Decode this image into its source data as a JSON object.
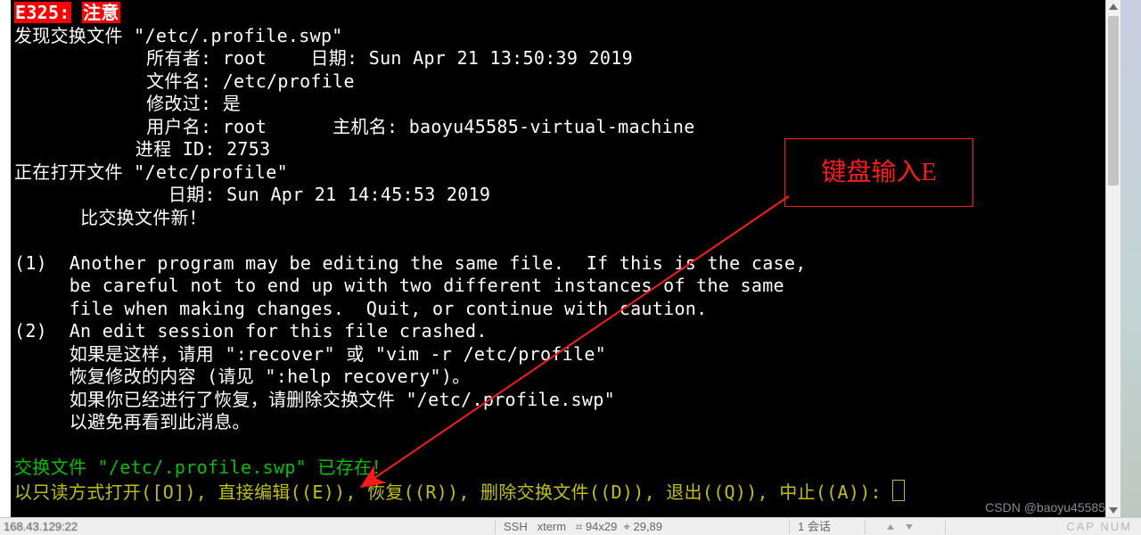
{
  "warning": {
    "code": "E325:",
    "label": "注意"
  },
  "swap": {
    "found_line": "发现交换文件 \"/etc/.profile.swp\"",
    "owner_label": "所有者:",
    "owner": "root",
    "date_label": "日期:",
    "date": "Sun Apr 21 13:50:39 2019",
    "filename_label": "文件名:",
    "filename": "/etc/profile",
    "modified_label": "修改过:",
    "modified": "是",
    "user_label": "用户名:",
    "user": "root",
    "host_label": "主机名:",
    "host": "baoyu45585-virtual-machine",
    "pid_label": "进程 ID:",
    "pid": "2753"
  },
  "opening": {
    "line": "正在打开文件 \"/etc/profile\"",
    "date_label": "日期:",
    "date": "Sun Apr 21 14:45:53 2019",
    "newer": "比交换文件新！"
  },
  "msg": {
    "l1": "(1)  Another program may be editing the same file.  If this is the case,",
    "l2": "     be careful not to end up with two different instances of the same",
    "l3": "     file when making changes.  Quit, or continue with caution.",
    "l4": "(2)  An edit session for this file crashed.",
    "l5": "     如果是这样，请用 \":recover\" 或 \"vim -r /etc/profile\"",
    "l6": "     恢复修改的内容 (请见 \":help recovery\")。",
    "l7": "     如果你已经进行了恢复，请删除交换文件 \"/etc/.profile.swp\"",
    "l8": "     以避免再看到此消息。"
  },
  "prompt": {
    "exists": "交换文件 \"/etc/.profile.swp\" 已存在！",
    "options": "以只读方式打开([O]), 直接编辑((E)), 恢复((R)), 删除交换文件((D)), 退出((Q)), 中止((A)): "
  },
  "annotation": {
    "text": "键盘输入E"
  },
  "status": {
    "ip": "168.43.129:22",
    "ssh": "SSH",
    "term": "xterm",
    "size": "94x29",
    "pos": "29,89",
    "sessions": "1 会话",
    "capnum": "CAP  NUM"
  },
  "watermark": "CSDN @baoyu45585"
}
